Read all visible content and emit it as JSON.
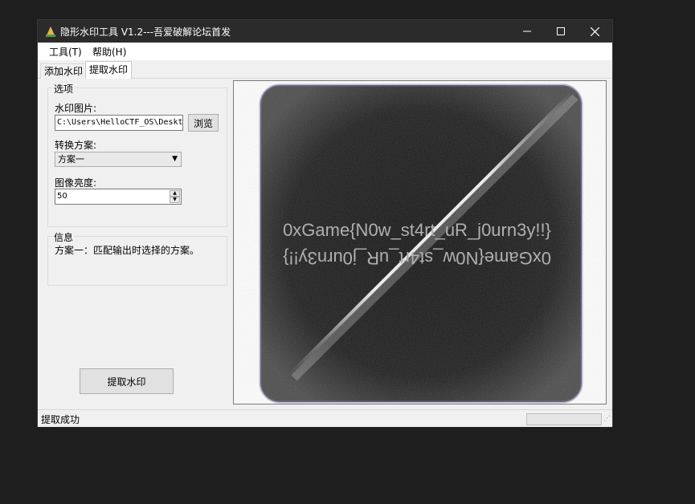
{
  "window": {
    "title": "隐形水印工具 V1.2---吾爱破解论坛首发"
  },
  "menu": {
    "tools": "工具(T)",
    "help": "帮助(H)"
  },
  "tabs": {
    "add": "添加水印",
    "extract": "提取水印"
  },
  "options": {
    "title": "选项",
    "image_label": "水印图片:",
    "image_path": "C:\\Users\\HelloCTF_OS\\Deskto",
    "browse_label": "浏览",
    "scheme_label": "转换方案:",
    "scheme_value": "方案一",
    "brightness_label": "图像亮度:",
    "brightness_value": "50"
  },
  "info": {
    "title": "信息",
    "text": "方案一：匹配输出时选择的方案。"
  },
  "extract_button": "提取水印",
  "preview": {
    "watermark_text": "0xGame{N0w_st4rt_uR_j0urn3y!!}"
  },
  "status": {
    "text": "提取成功"
  },
  "colors": {
    "titlebar": "#2b2b2b",
    "desktop": "#1e1e1e",
    "window_bg": "#f0f0f0"
  }
}
